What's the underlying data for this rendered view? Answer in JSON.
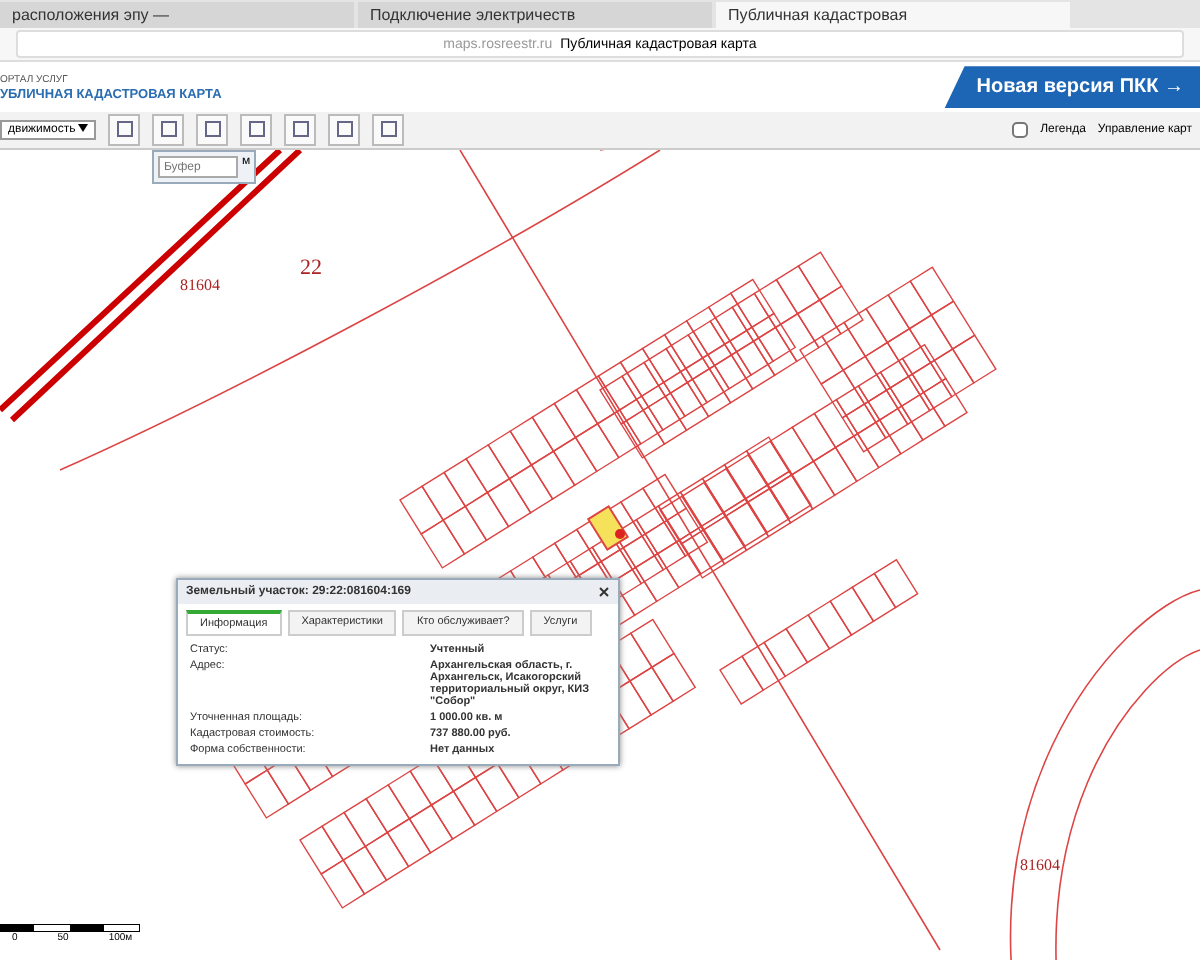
{
  "browser": {
    "tabs": [
      {
        "label": "расположения эпу —",
        "selected": false
      },
      {
        "label": "Подключение электричеств",
        "selected": false
      },
      {
        "label": "Публичная кадастровая",
        "selected": true
      }
    ],
    "address": {
      "host": "maps.rosreestr.ru",
      "title": "Публичная кадастровая карта"
    }
  },
  "header": {
    "portal": "ОРТАЛ УСЛУГ",
    "title": "УБЛИЧНАЯ КАДАСТРОВАЯ КАРТА",
    "new_version": "Новая версия ПКК →"
  },
  "toolbar": {
    "layer_select": "движимость",
    "buffer": {
      "placeholder": "Буфер",
      "unit": "м"
    },
    "legend": {
      "label": "Легенда",
      "checked": false
    },
    "map_control": "Управление карт"
  },
  "map": {
    "labels": [
      "81604",
      "22",
      "81604"
    ],
    "popup": {
      "title": "Земельный участок: 29:22:081604:169",
      "tabs": [
        {
          "label": "Информация",
          "selected": true
        },
        {
          "label": "Характеристики",
          "selected": false
        },
        {
          "label": "Кто обслуживает?",
          "selected": false
        },
        {
          "label": "Услуги",
          "selected": false
        }
      ],
      "rows": [
        {
          "label": "Статус:",
          "value": "Учтенный"
        },
        {
          "label": "Адрес:",
          "value": "Архангельская область, г. Архангельск, Исакогорский территориальный округ, КИЗ \"Собор\""
        },
        {
          "label": "Уточненная площадь:",
          "value": "1 000.00 кв. м"
        },
        {
          "label": "Кадастровая стоимость:",
          "value": "737 880.00 руб."
        },
        {
          "label": "Форма собственности:",
          "value": "Нет данных"
        }
      ]
    },
    "scale": [
      "0",
      "50",
      "100м"
    ]
  }
}
